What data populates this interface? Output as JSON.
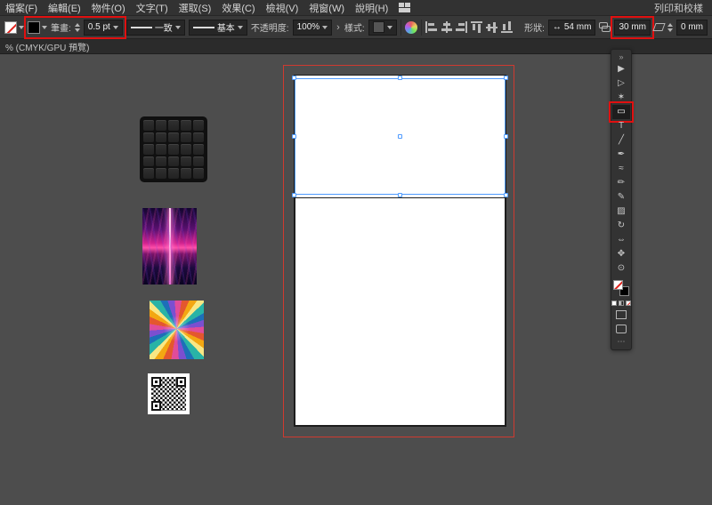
{
  "colors": {
    "annotation_red": "#e01010",
    "selection_blue": "#4f9bff",
    "bleed_red": "#cf3a30",
    "panel_bg": "#323232",
    "canvas_bg": "#4d4d4d",
    "artboard_white": "#ffffff"
  },
  "menu_bar": {
    "items": [
      "檔案(F)",
      "編輯(E)",
      "物件(O)",
      "文字(T)",
      "選取(S)",
      "效果(C)",
      "檢視(V)",
      "視窗(W)",
      "說明(H)"
    ],
    "workspace": "列印和校樣"
  },
  "control_bar": {
    "stroke_label": "筆畫:",
    "stroke_value": "0.5 pt",
    "width_profile": "一致",
    "brush": "基本",
    "opacity_label": "不透明度:",
    "opacity_value": "100%",
    "opacity_chevron": "›",
    "style_label": "樣式:",
    "shape_label": "形狀:",
    "shape_width": "54 mm",
    "shape_height": "30 mm",
    "shear_value": "0 mm"
  },
  "document_tab": {
    "title": "% (CMYK/GPU 預覽)"
  },
  "toolbar": {
    "collapse_glyph": "»",
    "more_glyph": "⋯",
    "tools": [
      {
        "name": "selection",
        "glyph": "▶"
      },
      {
        "name": "direct-selection",
        "glyph": "▷"
      },
      {
        "name": "magic-wand",
        "glyph": "✶"
      },
      {
        "name": "rectangle",
        "glyph": "▭",
        "selected": true
      },
      {
        "name": "type",
        "glyph": "T"
      },
      {
        "name": "line-segment",
        "glyph": "╱"
      },
      {
        "name": "pen",
        "glyph": "✒"
      },
      {
        "name": "curvature",
        "glyph": "≈"
      },
      {
        "name": "paintbrush",
        "glyph": "✏"
      },
      {
        "name": "pencil",
        "glyph": "✎"
      },
      {
        "name": "shaper",
        "glyph": "▨"
      },
      {
        "name": "rotate",
        "glyph": "↻"
      },
      {
        "name": "scale",
        "glyph": "⇔"
      },
      {
        "name": "hand",
        "glyph": "✥"
      },
      {
        "name": "zoom",
        "glyph": "⊙"
      }
    ]
  },
  "canvas": {
    "assets": [
      "keypad-photo",
      "neon-grid-photo",
      "paint-swirl-photo",
      "qr-code-image"
    ]
  }
}
